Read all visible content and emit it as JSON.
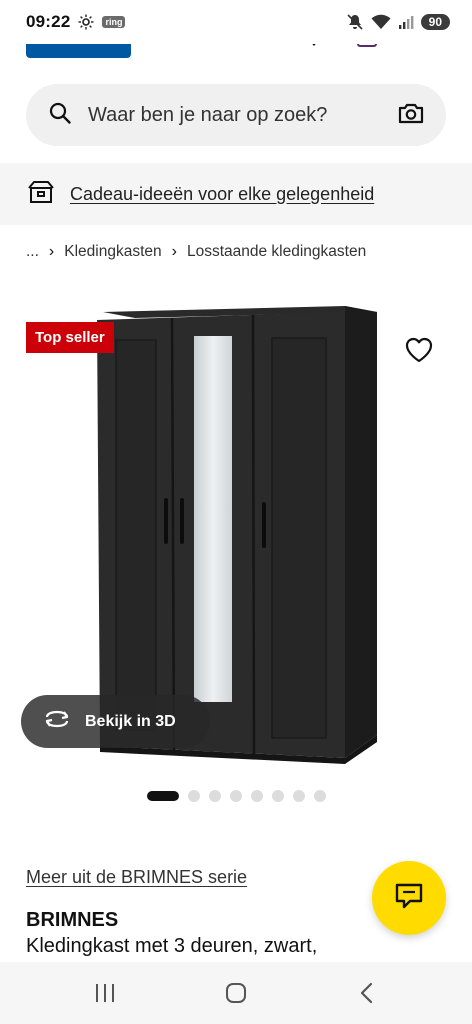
{
  "status": {
    "time": "09:22",
    "ring": "ring",
    "battery": "90"
  },
  "search": {
    "placeholder": "Waar ben je naar op zoek?"
  },
  "promo": {
    "text": "Cadeau-ideeën voor elke gelegenheid"
  },
  "breadcrumb": {
    "ellipsis": "...",
    "items": [
      "Kledingkasten",
      "Losstaande kledingkasten"
    ]
  },
  "product": {
    "badge": "Top seller",
    "view3d": "Bekijk in 3D",
    "series_link": "Meer uit de BRIMNES serie",
    "name": "BRIMNES",
    "description": "Kledingkast met 3 deuren, zwart,"
  },
  "carousel": {
    "total": 8,
    "active": 1
  },
  "colors": {
    "accent_yellow": "#ffdb00",
    "brand_blue": "#0058a3",
    "badge_red": "#cc0008"
  }
}
